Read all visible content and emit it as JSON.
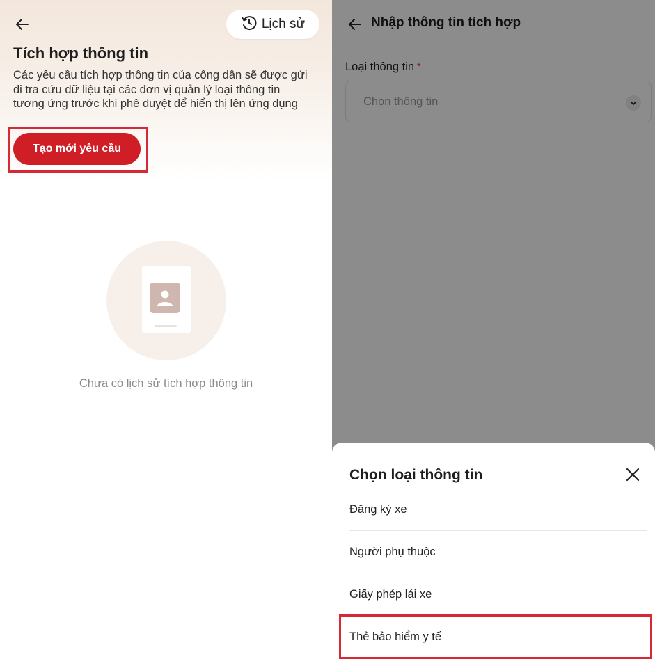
{
  "left": {
    "history_label": "Lịch sử",
    "title": "Tích hợp thông tin",
    "description": "Các yêu cầu tích hợp thông tin của công dân sẽ được gửi đi tra cứu dữ liệu tại các đơn vị quản lý loại thông tin tương ứng trước khi phê duyệt để hiển thị lên ứng dụng",
    "create_button": "Tạo mới yêu cầu",
    "empty_text": "Chưa có lịch sử tích hợp thông tin"
  },
  "right": {
    "header_title": "Nhập thông tin tích hợp",
    "field_label": "Loại thông tin",
    "required_mark": "*",
    "select_placeholder": "Chọn thông tin",
    "sheet": {
      "title": "Chọn loại thông tin",
      "options": [
        {
          "label": "Đăng ký xe"
        },
        {
          "label": "Người phụ thuộc"
        },
        {
          "label": "Giấy phép lái xe"
        },
        {
          "label": "Thẻ bảo hiểm y tế"
        }
      ]
    }
  },
  "colors": {
    "brand_red": "#d01e27",
    "highlight_red": "#d52a35",
    "overlay": "rgba(0,0,0,0.45)"
  },
  "icons": [
    "back-arrow-icon",
    "history-clock-icon",
    "person-card-icon",
    "chevron-down-icon",
    "close-icon"
  ]
}
